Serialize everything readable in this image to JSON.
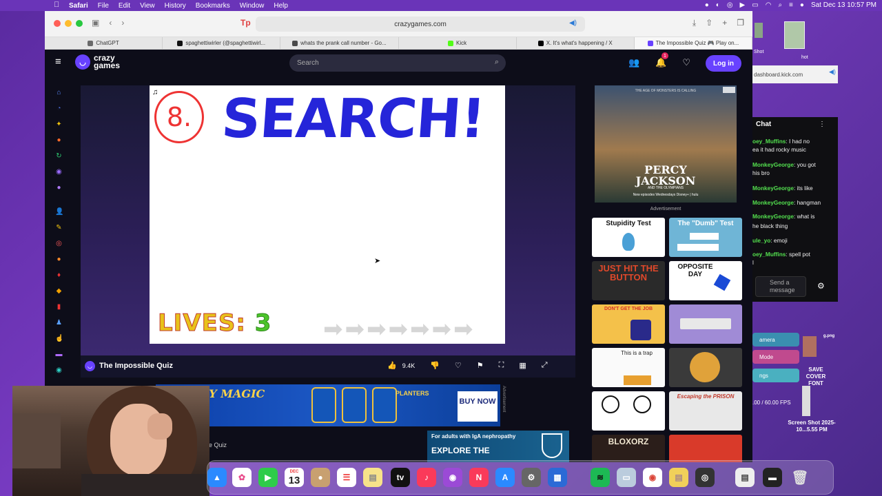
{
  "menubar": {
    "app": "Safari",
    "items": [
      "File",
      "Edit",
      "View",
      "History",
      "Bookmarks",
      "Window",
      "Help"
    ],
    "datetime": "Sat Dec 13  10:57 PM"
  },
  "browser": {
    "url": "crazygames.com",
    "tabs": [
      {
        "label": "ChatGPT",
        "color": "#6a6a6a"
      },
      {
        "label": "spaghettiwirler (@spaghettiwirl...",
        "color": "#111111"
      },
      {
        "label": "whats the prank call number - Go...",
        "color": "#4a4a4a"
      },
      {
        "label": "Kick",
        "color": "#53fc18"
      },
      {
        "label": "X. It's what's happening / X",
        "color": "#000000"
      },
      {
        "label": "The Impossible Quiz 🎮 Play on...",
        "color": "#6842ff"
      }
    ]
  },
  "crazygames": {
    "logo_line1": "crazy",
    "logo_line2": "games",
    "search_placeholder": "Search",
    "notif_count": "1",
    "login_label": "Log in",
    "game_title": "The Impossible Quiz",
    "likes": "9.4K",
    "bottom_title_fragment": "le Quiz"
  },
  "game": {
    "question_number": "8.",
    "question_word": "SEARCH!",
    "lives_label": "LIVES:",
    "lives_value": "3",
    "skip_arrows": 7
  },
  "ads": {
    "banner_headline": "HOLIDAY MAGIC",
    "banner_brand": "PLANTERS",
    "banner_cta": "BUY NOW",
    "banner_label": "Advertisement",
    "igan_line1": "For adults with IgA nephropathy",
    "igan_line2": "EXPLORE THE",
    "poster_top": "THE AGE OF MONSTERS IS CALLING",
    "poster_title_1": "PERCY",
    "poster_title_2": "JACKSON",
    "poster_title_3": "AND THE OLYMPIANS",
    "poster_sub": "New episodes Wednesdays  Disney+ | hulu",
    "side_label": "Advertisement"
  },
  "recommended": [
    {
      "label": "Stupidity Test",
      "bg": "#ffffff",
      "fg": "#111111"
    },
    {
      "label": "The \"Dumb\" Test",
      "bg": "#6fb5d6",
      "fg": "#ffffff"
    },
    {
      "label": "JUST HIT THE BUTTON",
      "bg": "#2a2a2a",
      "fg": "#e0482a"
    },
    {
      "label": "OPPOSITE DAY",
      "bg": "#ffffff",
      "fg": "#111111"
    },
    {
      "label": "DON'T GET THE JOB",
      "bg": "#f4c14a",
      "fg": "#d6312a"
    },
    {
      "label": "",
      "bg": "#a08bd6",
      "fg": "#ffffff"
    },
    {
      "label": "This is a trap",
      "bg": "#fafafa",
      "fg": "#222222"
    },
    {
      "label": "",
      "bg": "#3a3a3a",
      "fg": "#ffffff"
    },
    {
      "label": "",
      "bg": "#ffffff",
      "fg": "#111111"
    },
    {
      "label": "Escaping the PRISON",
      "bg": "#e8e8e8",
      "fg": "#c0392b"
    },
    {
      "label": "BLOXORZ",
      "bg": "#2b1e1a",
      "fg": "#f0e6d0"
    },
    {
      "label": "",
      "bg": "#d93a2a",
      "fg": "#ffffff"
    }
  ],
  "background": {
    "dashboard_url": "dashboard.kick.com",
    "screenshot_label_left": "Shot",
    "screenshot_label_right": "hot",
    "chat_title": "Chat",
    "chat": [
      {
        "user": "oey_Muffins",
        "text": ": I had no"
      },
      {
        "user": "",
        "text": "ea it had rocky music"
      },
      {
        "user": "MonkeyGeorge",
        "text": ": you got"
      },
      {
        "user": "",
        "text": "his bro"
      },
      {
        "user": "MonkeyGeorge",
        "text": ": its like"
      },
      {
        "user": "MonkeyGeorge",
        "text": ": hangman"
      },
      {
        "user": "MonkeyGeorge",
        "text": ": what is"
      },
      {
        "user": "",
        "text": "he black thing"
      },
      {
        "user": "ule_yo",
        "text": ": emoji"
      },
      {
        "user": "oey_Muffins",
        "text": ": spell pot"
      },
      {
        "user": "",
        "text": "l"
      }
    ],
    "chat_input": "Send a message",
    "obs_items": [
      "amera",
      "Mode",
      "ngs"
    ],
    "obs_fps": ".00 / 60.00 FPS",
    "desktop_file_1": "SAVE COVER FONT",
    "desktop_file_2": "Screen Shot 2025-10...5.55 PM",
    "desktop_png": "g.png"
  },
  "dock": {
    "calendar_month": "DEC",
    "calendar_day": "13"
  }
}
